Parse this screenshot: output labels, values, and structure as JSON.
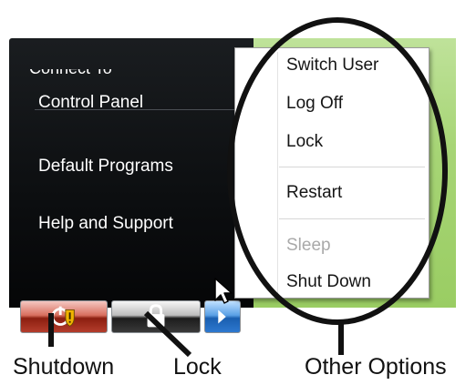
{
  "start_menu": {
    "cut_item": "Connect To",
    "items": [
      "Control Panel",
      "Default Programs",
      "Help and Support"
    ]
  },
  "power_menu": {
    "items": [
      {
        "label": "Switch User",
        "enabled": true
      },
      {
        "label": "Log Off",
        "enabled": true
      },
      {
        "label": "Lock",
        "enabled": true
      },
      {
        "label": "Restart",
        "enabled": true
      },
      {
        "label": "Sleep",
        "enabled": false
      },
      {
        "label": "Shut Down",
        "enabled": true
      }
    ]
  },
  "buttons": {
    "shutdown_icon": "shield-power-icon",
    "lock_icon": "padlock-icon",
    "arrow_icon": "arrow-right-icon"
  },
  "annotations": {
    "shutdown": "Shutdown",
    "lock": "Lock",
    "other": "Other Options"
  },
  "colors": {
    "menu_bg": "#0c0e10",
    "desktop_green": "#a7d576",
    "disabled_text": "#a9a9a9",
    "annotation": "#111111"
  }
}
